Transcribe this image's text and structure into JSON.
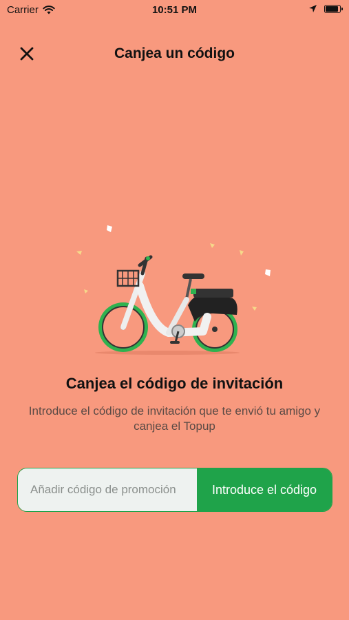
{
  "status_bar": {
    "carrier": "Carrier",
    "time": "10:51 PM",
    "battery_level": 0.95,
    "icons": [
      "wifi-icon",
      "location-arrow-icon",
      "battery-icon"
    ]
  },
  "nav": {
    "title": "Canjea un código",
    "close_icon": "close-icon"
  },
  "content": {
    "headline": "Canjea el código de invitación",
    "description": "Introduce el código de invitación que te envió tu amigo y canjea el Topup"
  },
  "form": {
    "placeholder": "Añadir código de promoción",
    "value": "",
    "submit_label": "Introduce el código"
  },
  "colors": {
    "background": "#F8997E",
    "accent": "#1FA34A",
    "input_bg": "#EEF2F0"
  }
}
